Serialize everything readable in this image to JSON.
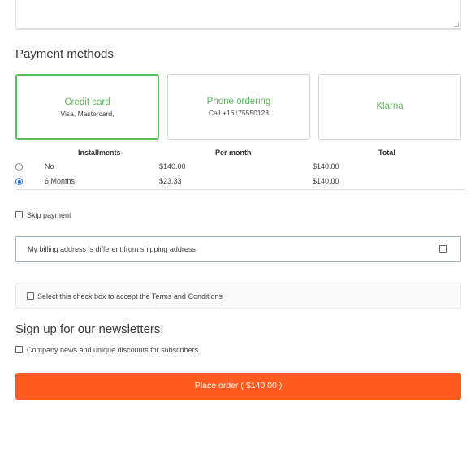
{
  "payment": {
    "title": "Payment methods",
    "methods": [
      {
        "name": "Credit card",
        "sub": "Visa, Mastercard,",
        "selected": true
      },
      {
        "name": "Phone ordering",
        "sub": "Call +16175550123",
        "selected": false
      },
      {
        "name": "Klarna",
        "sub": "",
        "selected": false
      }
    ]
  },
  "installments": {
    "headers": [
      "Installments",
      "Per month",
      "Total"
    ],
    "rows": [
      {
        "label": "No",
        "per_month": "$140.00",
        "total": "$140.00",
        "selected": false
      },
      {
        "label": "6 Months",
        "per_month": "$23.33",
        "total": "$140.00",
        "selected": true
      }
    ]
  },
  "skip_payment": {
    "label": "Skip payment",
    "checked": false
  },
  "billing": {
    "label": "My billing address is different from shipping address",
    "checked": false
  },
  "terms": {
    "prefix": "Select this check box to accept the",
    "link": "Terms and Conditions",
    "checked": false
  },
  "newsletter": {
    "title": "Sign up for our newsletters!",
    "option_label": "Company news and unique discounts for subscribers",
    "checked": false
  },
  "place_order": {
    "label": "Place order ( $140.00 )"
  },
  "colors": {
    "accent_green": "#5fb55d",
    "selected_border": "#59c05f",
    "order_button": "#ff5a1f",
    "radio_blue": "#1a73e8"
  }
}
